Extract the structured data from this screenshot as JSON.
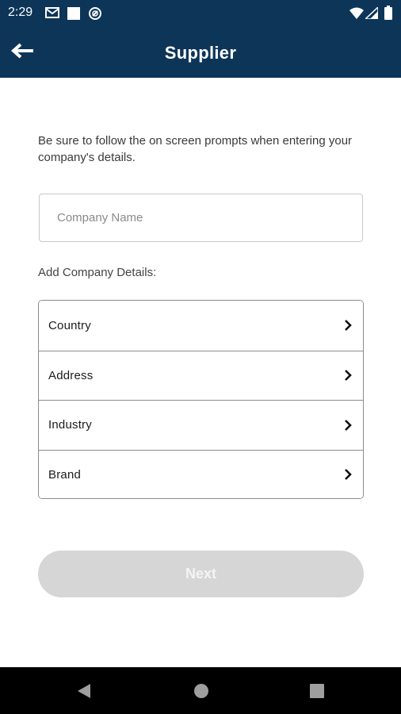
{
  "status_bar": {
    "time": "2:29",
    "left_icons": [
      "gmail-icon",
      "square-notification-icon",
      "sync-icon"
    ],
    "right_icons": [
      "wifi-icon",
      "signal-icon",
      "battery-icon"
    ]
  },
  "app_bar": {
    "title": "Supplier",
    "background_color": "#0d3558",
    "back_icon": "arrow-left-icon"
  },
  "form": {
    "intro_text": "Be sure to follow the on screen prompts when entering your company's details.",
    "company_name": {
      "value": "",
      "placeholder": "Company Name"
    },
    "details_label": "Add Company Details:",
    "details_items": [
      {
        "label": "Country",
        "icon": "chevron-right-icon"
      },
      {
        "label": "Address",
        "icon": "chevron-right-icon"
      },
      {
        "label": "Industry",
        "icon": "chevron-right-icon"
      },
      {
        "label": "Brand",
        "icon": "chevron-right-icon"
      }
    ],
    "next_button": {
      "label": "Next",
      "enabled": false,
      "color": "#d6d6d6"
    }
  },
  "nav_bar": {
    "buttons": [
      "back-triangle-icon",
      "home-circle-icon",
      "recents-square-icon"
    ]
  }
}
